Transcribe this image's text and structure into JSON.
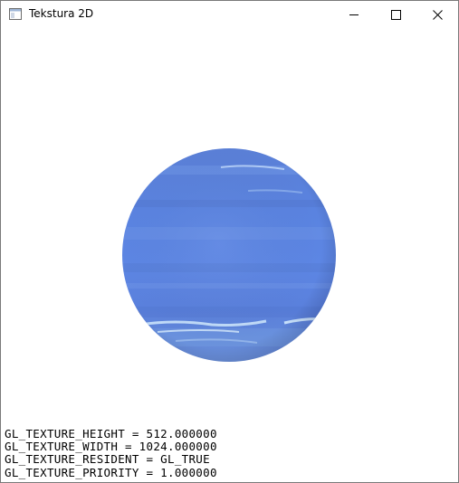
{
  "window": {
    "title": "Tekstura 2D",
    "app_icon": "window-app-icon",
    "controls": {
      "minimize_icon": "minimize-icon",
      "maximize_icon": "maximize-icon",
      "close_icon": "close-icon"
    }
  },
  "scene": {
    "object": "textured-sphere",
    "colors": {
      "base": "#5b82e0",
      "light_band": "#7aa0ea",
      "dark_band": "#4a6cc0",
      "storm_spot": "#2a2a4a",
      "cloud_streak": "#d8f0ff"
    }
  },
  "info": {
    "lines": [
      "GL_TEXTURE_HEIGHT = 512.000000",
      "GL_TEXTURE_WIDTH = 1024.000000",
      "GL_TEXTURE_RESIDENT = GL_TRUE",
      "GL_TEXTURE_PRIORITY = 1.000000"
    ]
  }
}
